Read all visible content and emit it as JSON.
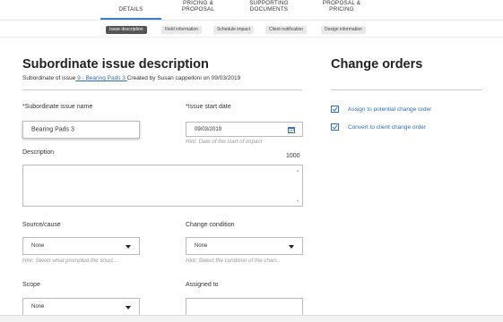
{
  "tabs": [
    {
      "line1": "DETAILS",
      "line2": ""
    },
    {
      "line1": "PRICING &",
      "line2": "PROPOSAL"
    },
    {
      "line1": "SUPPORTING",
      "line2": "DOCUMENTS"
    },
    {
      "line1": "PROPOSAL &",
      "line2": "PRICING"
    }
  ],
  "subtabs": [
    "Issue description",
    "Field information",
    "Schedule impact",
    "Client notification",
    "Design information"
  ],
  "section": {
    "title": "Subordinate issue description",
    "subtitle_prefix": "Subordinate of issue",
    "subtitle_link": " 9 - Bearing Pads 3 ",
    "subtitle_suffix": "Created by Susan cappelloni on 09/03/2019"
  },
  "form": {
    "name_label": "*Subordinate issue name",
    "name_value": "Bearing Pads 3",
    "start_label": "*Issue start date",
    "start_value": "09/03/2019",
    "start_hint": "Hint: Date of the start of impact",
    "description_label": "Description",
    "description_count": "1000",
    "source_label": "Source/cause",
    "source_value": "None",
    "source_hint": "Hint: Select what prompted the sourc...",
    "condition_label": "Change condition",
    "condition_value": "None",
    "condition_hint": "Hint: Select the condition of the chan...",
    "scope_label": "Scope",
    "scope_value": "None",
    "assigned_label": "Assigned to",
    "assigned_value": ""
  },
  "change_orders": {
    "title": "Change orders",
    "assign_label": "Assign to potential change order",
    "convert_label": "Convert to client change order"
  },
  "colors": {
    "accent": "#2f6fb8",
    "active_chip": "#555555"
  }
}
